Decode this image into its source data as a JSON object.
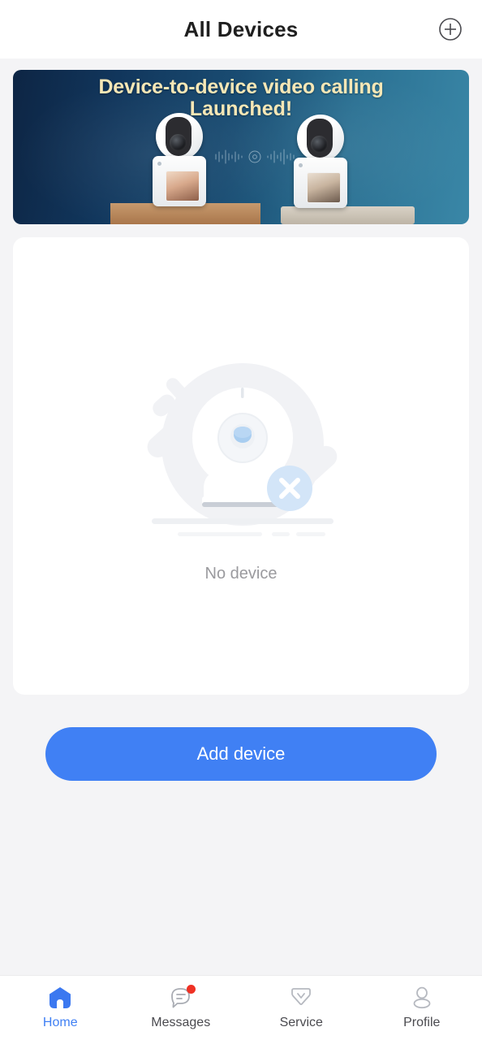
{
  "header": {
    "title": "All Devices",
    "add_icon": "plus-circle-icon"
  },
  "banner": {
    "line1": "Device-to-device video calling",
    "line2": "Launched!",
    "alt": "promo-banner-video-calling"
  },
  "empty_state": {
    "text": "No device",
    "illustration": "offline-camera-illustration"
  },
  "primary_action": {
    "label": "Add device"
  },
  "tabbar": {
    "items": [
      {
        "label": "Home",
        "icon": "home-icon",
        "active": true,
        "badge": false
      },
      {
        "label": "Messages",
        "icon": "message-icon",
        "active": false,
        "badge": true
      },
      {
        "label": "Service",
        "icon": "diamond-icon",
        "active": false,
        "badge": false
      },
      {
        "label": "Profile",
        "icon": "person-icon",
        "active": false,
        "badge": false
      }
    ]
  },
  "colors": {
    "accent": "#4080f4",
    "background": "#f4f4f6",
    "card": "#ffffff",
    "badge": "#ef3124",
    "banner_text": "#f6e7b6",
    "muted_text": "#9a9a9e"
  }
}
